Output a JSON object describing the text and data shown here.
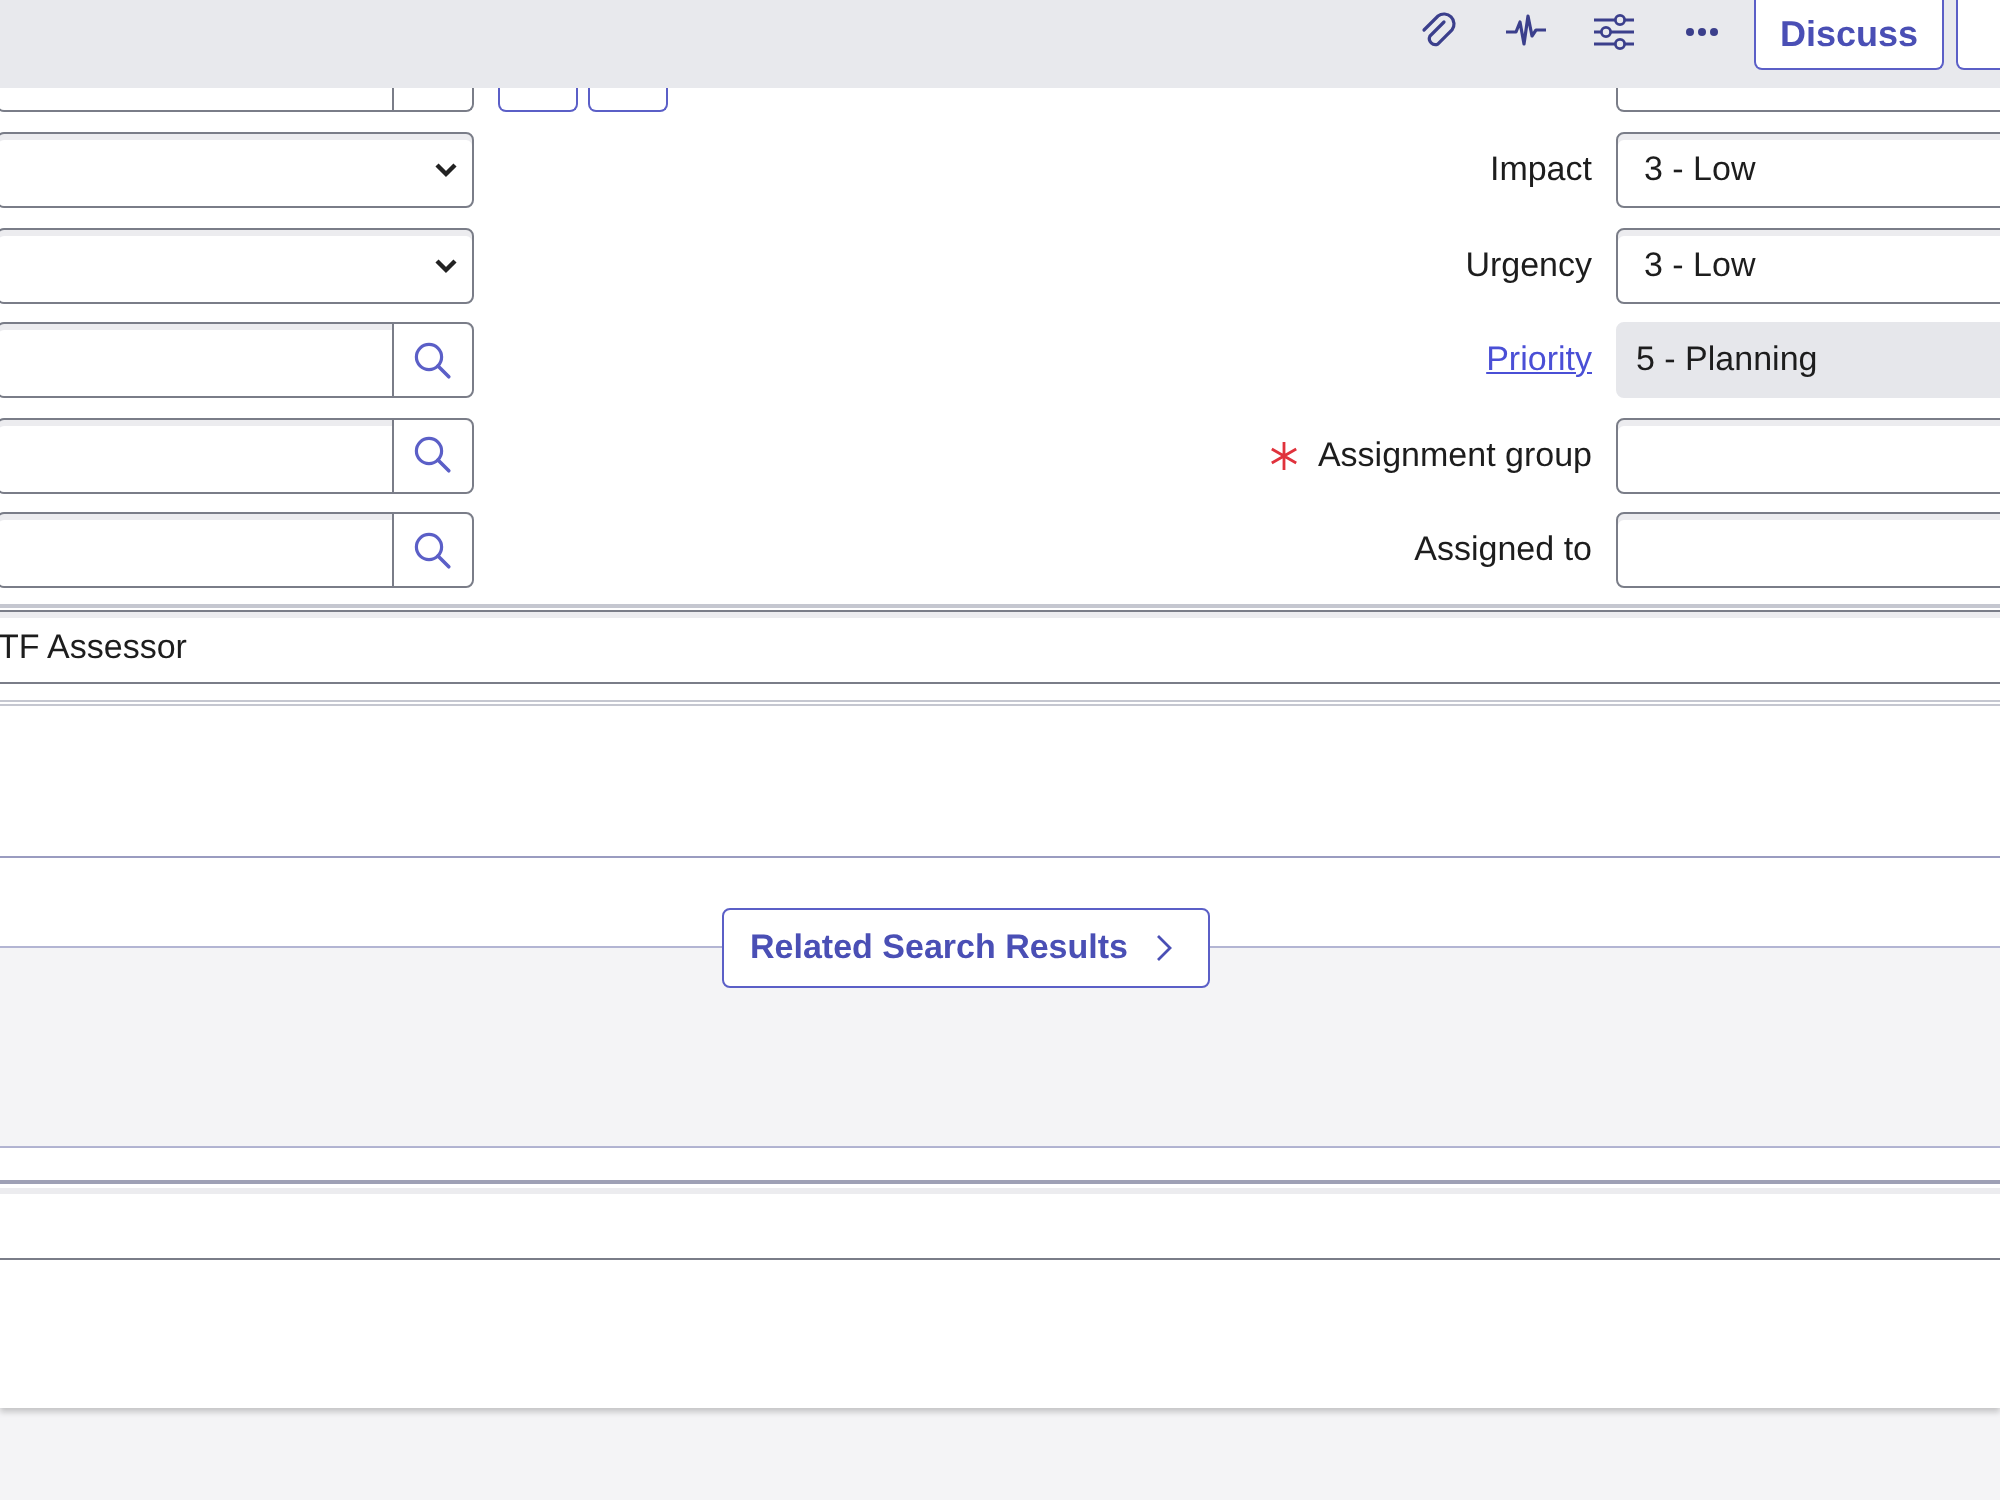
{
  "header": {
    "discuss_button": "Discuss"
  },
  "form": {
    "rows": [
      {
        "left": {
          "kind": "lookup_buttons"
        },
        "right": {
          "kind": "input"
        }
      },
      {
        "left": {
          "kind": "select"
        },
        "right": {
          "kind": "input",
          "label": "Impact",
          "label_link": false,
          "required": false,
          "value": "3 - Low"
        }
      },
      {
        "left": {
          "kind": "select"
        },
        "right": {
          "kind": "input",
          "label": "Urgency",
          "label_link": false,
          "required": false,
          "value": "3 - Low"
        }
      },
      {
        "left": {
          "kind": "lookup"
        },
        "right": {
          "kind": "readonly",
          "label": "Priority",
          "label_link": true,
          "required": false,
          "value": "5 - Planning"
        }
      },
      {
        "left": {
          "kind": "lookup"
        },
        "right": {
          "kind": "input",
          "label": "Assignment group",
          "label_link": false,
          "required": true
        }
      },
      {
        "left": {
          "kind": "lookup"
        },
        "right": {
          "kind": "input",
          "label": "Assigned to",
          "label_link": false,
          "required": false
        }
      }
    ],
    "wide_field": {
      "value": "TF Assessor"
    }
  },
  "related_search_button": "Related Search Results"
}
